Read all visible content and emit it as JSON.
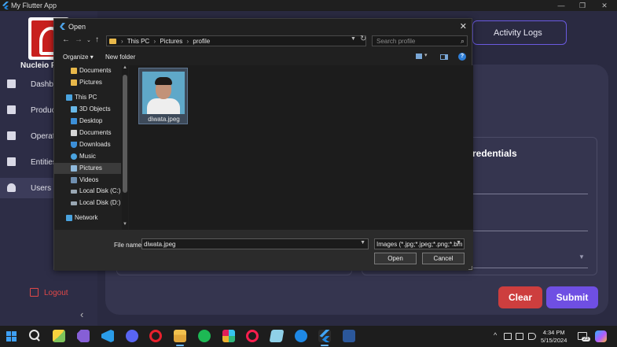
{
  "app": {
    "window_title": "My Flutter App",
    "brand": "Nucleio Ph",
    "nav": [
      {
        "label": "Dashbo"
      },
      {
        "label": "Product"
      },
      {
        "label": "Operati"
      },
      {
        "label": "Entities"
      },
      {
        "label": "Users"
      }
    ],
    "logout_label": "Logout",
    "activity_logs_label": "Activity Logs",
    "credentials_title": "redentials",
    "clear_label": "Clear",
    "submit_label": "Submit",
    "colors": {
      "accent": "#6f4fe3",
      "danger": "#cd3e3e",
      "bg": "#2a2a41"
    }
  },
  "dialog": {
    "title": "Open",
    "breadcrumbs": [
      "This PC",
      "Pictures",
      "profile"
    ],
    "search_placeholder": "Search profile",
    "organize_label": "Organize",
    "new_folder_label": "New folder",
    "tree": [
      {
        "label": "Documents",
        "icon": "folder-icon"
      },
      {
        "label": "Pictures",
        "icon": "folder-icon"
      },
      {
        "label": "This PC",
        "icon": "computer-icon"
      },
      {
        "label": "3D Objects",
        "icon": "cube-icon"
      },
      {
        "label": "Desktop",
        "icon": "desktop-icon"
      },
      {
        "label": "Documents",
        "icon": "document-icon"
      },
      {
        "label": "Downloads",
        "icon": "download-icon"
      },
      {
        "label": "Music",
        "icon": "music-icon"
      },
      {
        "label": "Pictures",
        "icon": "pictures-icon",
        "selected": true
      },
      {
        "label": "Videos",
        "icon": "video-icon"
      },
      {
        "label": "Local Disk (C:)",
        "icon": "disk-icon"
      },
      {
        "label": "Local Disk (D:)",
        "icon": "disk-icon"
      },
      {
        "label": "Network",
        "icon": "network-icon"
      }
    ],
    "file": {
      "name": "diwata.jpeg"
    },
    "file_name_label": "File name:",
    "file_name_value": "diwata.jpeg",
    "file_type_value": "Images (*.jpg;*.jpeg;*.png;*.bm",
    "open_label": "Open",
    "cancel_label": "Cancel"
  },
  "taskbar": {
    "apps": [
      "start-icon",
      "search-icon",
      "sticky-notes-icon",
      "visual-studio-icon",
      "vscode-icon",
      "discord-icon",
      "opera-icon",
      "file-explorer-icon",
      "spotify-icon",
      "slack-icon",
      "opera-gx-icon",
      "notepad-icon",
      "app-store-icon",
      "flutter-icon",
      "word-icon"
    ],
    "time": "4:34 PM",
    "date": "5/15/2024",
    "notification_count": "23"
  }
}
